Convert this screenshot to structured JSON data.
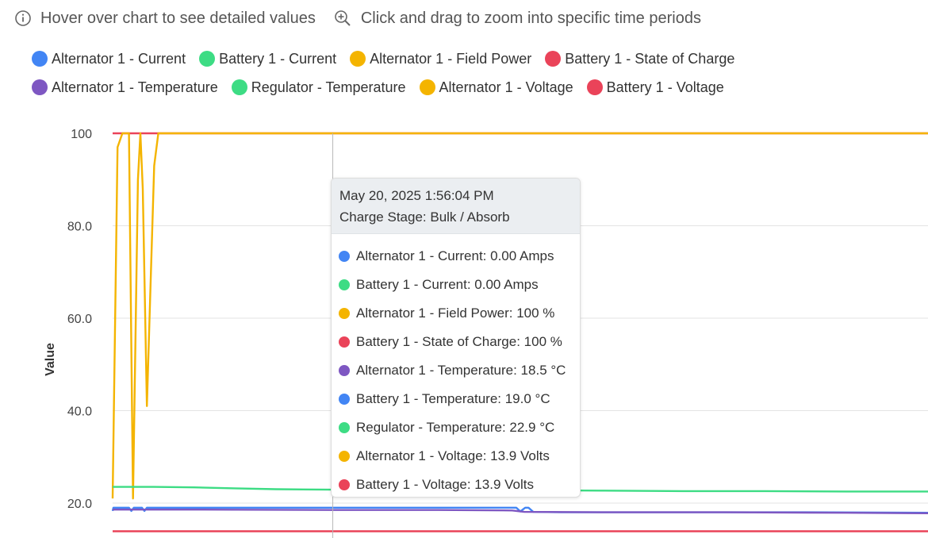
{
  "hints": {
    "hover": "Hover over chart to see detailed values",
    "zoom": "Click and drag to zoom into specific time periods"
  },
  "legend": [
    {
      "label": "Alternator 1 - Current",
      "color": "#4285f4"
    },
    {
      "label": "Battery 1 - Current",
      "color": "#3ddc84"
    },
    {
      "label": "Alternator 1 - Field Power",
      "color": "#f4b400"
    },
    {
      "label": "Battery 1 - State of Charge",
      "color": "#ea4359"
    },
    {
      "label": "Alternator 1 - Temperature",
      "color": "#7e57c2"
    },
    {
      "label": "Regulator - Temperature",
      "color": "#3ddc84"
    },
    {
      "label": "Alternator 1 - Voltage",
      "color": "#f4b400"
    },
    {
      "label": "Battery 1 - Voltage",
      "color": "#ea4359"
    }
  ],
  "tooltip": {
    "timestamp": "May 20, 2025 1:56:04 PM",
    "charge_stage": "Charge Stage: Bulk / Absorb",
    "rows": [
      {
        "text": "Alternator 1 - Current: 0.00 Amps",
        "color": "#4285f4"
      },
      {
        "text": "Battery 1 - Current: 0.00 Amps",
        "color": "#3ddc84"
      },
      {
        "text": "Alternator 1 - Field Power: 100 %",
        "color": "#f4b400"
      },
      {
        "text": "Battery 1 - State of Charge: 100 %",
        "color": "#ea4359"
      },
      {
        "text": "Alternator 1 - Temperature: 18.5 °C",
        "color": "#7e57c2"
      },
      {
        "text": "Battery 1 - Temperature: 19.0 °C",
        "color": "#4285f4"
      },
      {
        "text": "Regulator - Temperature: 22.9 °C",
        "color": "#3ddc84"
      },
      {
        "text": "Alternator 1 - Voltage: 13.9 Volts",
        "color": "#f4b400"
      },
      {
        "text": "Battery 1 - Voltage: 13.9 Volts",
        "color": "#ea4359"
      }
    ]
  },
  "chart_data": {
    "type": "line",
    "ylabel": "Value",
    "ylim": [
      12,
      100
    ],
    "y_ticks": [
      "100",
      "80.0",
      "60.0",
      "40.0",
      "20.0"
    ],
    "y_tick_values": [
      100,
      80,
      60,
      40,
      20
    ],
    "grid": true,
    "cursor_time": "May 20, 2025 1:56:04 PM",
    "cursor_t": 27,
    "t_range": [
      0,
      100
    ],
    "series": [
      {
        "name": "Battery 1 - State of Charge",
        "color": "#ea4359",
        "points": [
          [
            0,
            100
          ],
          [
            100,
            100
          ]
        ]
      },
      {
        "name": "Alternator 1 - Field Power",
        "color": "#f4b400",
        "points": [
          [
            0,
            21
          ],
          [
            0.6,
            97
          ],
          [
            1.2,
            100
          ],
          [
            1.6,
            100
          ],
          [
            2.0,
            100
          ],
          [
            2.5,
            21
          ],
          [
            3.1,
            90
          ],
          [
            3.4,
            100
          ],
          [
            3.7,
            88
          ],
          [
            4.2,
            41
          ],
          [
            4.7,
            70
          ],
          [
            5.1,
            93
          ],
          [
            5.6,
            100
          ],
          [
            100,
            100
          ]
        ]
      },
      {
        "name": "Regulator - Temperature",
        "color": "#3ddc84",
        "points": [
          [
            0,
            23.5
          ],
          [
            5,
            23.5
          ],
          [
            10,
            23.4
          ],
          [
            15,
            23.2
          ],
          [
            20,
            23
          ],
          [
            27,
            22.9
          ],
          [
            40,
            22.9
          ],
          [
            50,
            22.8
          ],
          [
            60,
            22.7
          ],
          [
            70,
            22.6
          ],
          [
            80,
            22.6
          ],
          [
            90,
            22.5
          ],
          [
            100,
            22.5
          ]
        ]
      },
      {
        "name": "Battery 1 - Temperature",
        "color": "#4285f4",
        "points": [
          [
            0,
            18.3
          ],
          [
            0.1,
            19
          ],
          [
            2,
            19
          ],
          [
            2.3,
            18.3
          ],
          [
            2.6,
            19
          ],
          [
            3.6,
            19
          ],
          [
            3.9,
            18.3
          ],
          [
            4.2,
            19
          ],
          [
            10,
            19
          ],
          [
            27,
            19
          ],
          [
            40,
            19
          ],
          [
            49.5,
            19
          ],
          [
            50,
            18.2
          ],
          [
            50.6,
            19
          ],
          [
            51,
            19
          ],
          [
            51.6,
            18.1
          ],
          [
            55,
            18
          ],
          [
            70,
            18
          ],
          [
            85,
            18
          ],
          [
            100,
            17.9
          ]
        ]
      },
      {
        "name": "Alternator 1 - Temperature",
        "color": "#7e57c2",
        "points": [
          [
            0,
            18.6
          ],
          [
            10,
            18.6
          ],
          [
            27,
            18.5
          ],
          [
            40,
            18.5
          ],
          [
            49,
            18.4
          ],
          [
            50.5,
            18.1
          ],
          [
            60,
            18
          ],
          [
            75,
            18
          ],
          [
            90,
            17.9
          ],
          [
            100,
            17.8
          ]
        ]
      },
      {
        "name": "Battery 1 - Voltage",
        "color": "#ea4359",
        "points": [
          [
            0,
            13.9
          ],
          [
            100,
            13.9
          ]
        ]
      }
    ]
  }
}
